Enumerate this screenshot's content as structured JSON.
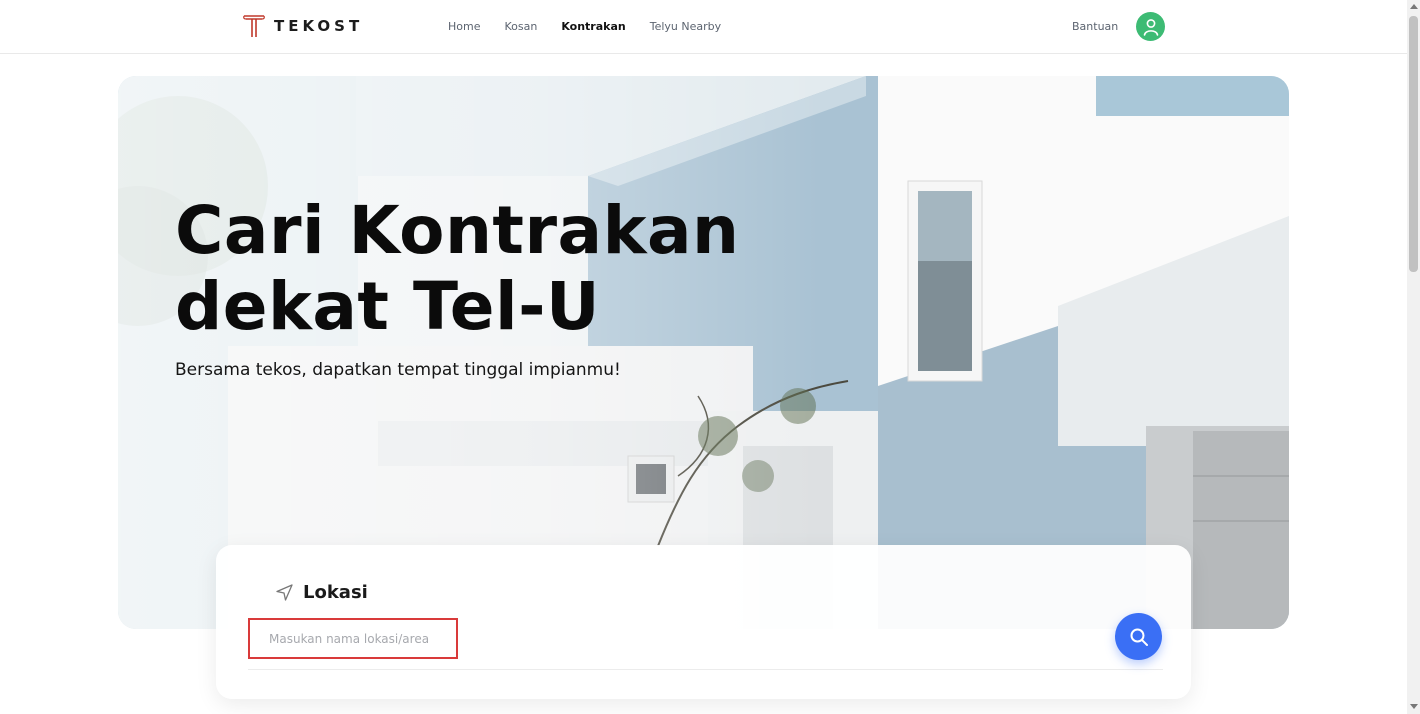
{
  "brand": {
    "name": "TEKOST",
    "accent": "#c0392b"
  },
  "nav": {
    "items": [
      {
        "label": "Home",
        "active": false
      },
      {
        "label": "Kosan",
        "active": false
      },
      {
        "label": "Kontrakan",
        "active": true
      },
      {
        "label": "Telyu Nearby",
        "active": false
      }
    ],
    "help_label": "Bantuan",
    "avatar_icon": "user-icon",
    "avatar_color": "#3dbb74"
  },
  "hero": {
    "title_line1": "Cari Kontrakan",
    "title_line2": "dekat Tel-U",
    "subtitle": "Bersama tekos, dapatkan tempat tinggal impianmu!"
  },
  "search": {
    "location_label": "Lokasi",
    "location_icon": "navigation-arrow-icon",
    "input_value": "",
    "placeholder": "Masukan nama lokasi/area",
    "button_icon": "search-icon",
    "button_color": "#3a6ff5"
  }
}
